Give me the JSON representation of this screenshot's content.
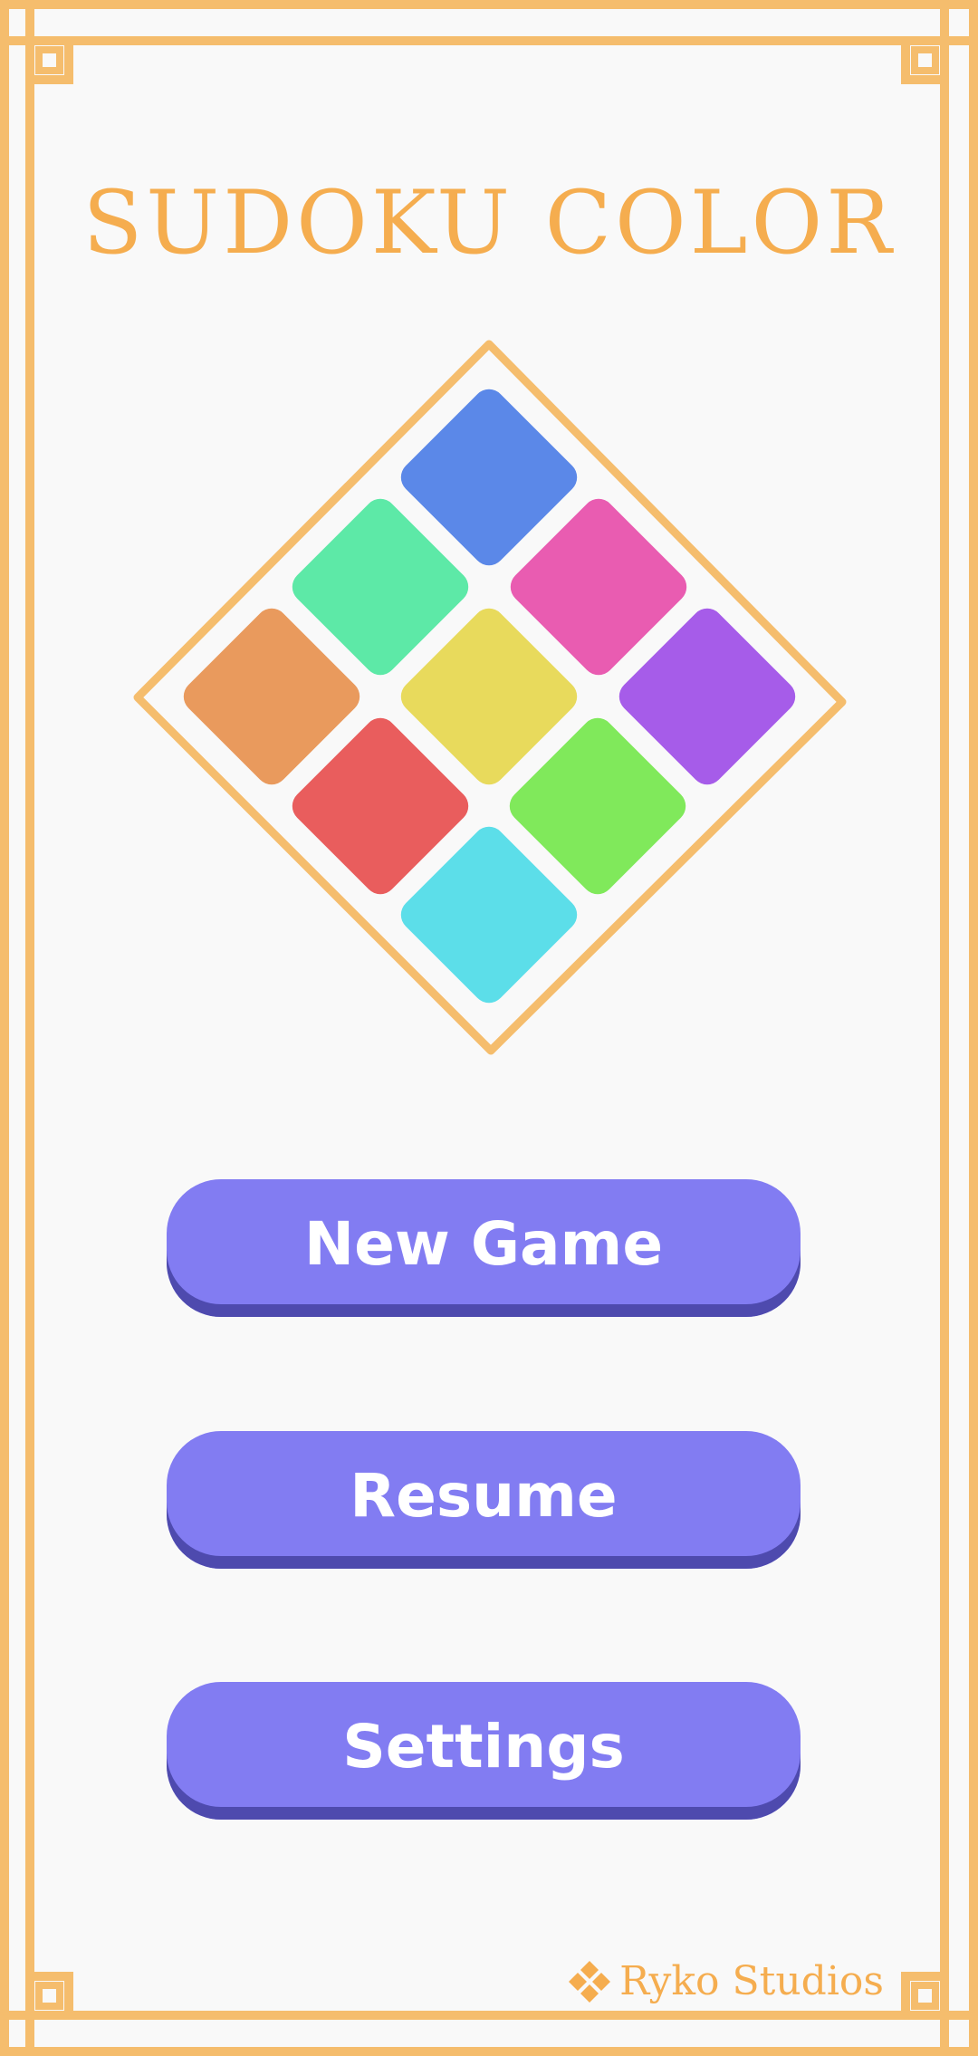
{
  "app": {
    "title": "SUDOKU COLOR"
  },
  "colors": {
    "accent": "#f5ad4f",
    "background": "#f9f9f9",
    "button": "#827cf2",
    "button_shadow": "#4e4aae",
    "tiles": [
      "#5b88e8",
      "#5de9a7",
      "#e95cb1",
      "#e99a5d",
      "#e8da5c",
      "#a65ce9",
      "#e95d5d",
      "#80e95b",
      "#5cdee9"
    ]
  },
  "menu": {
    "new_game_label": "New Game",
    "resume_label": "Resume",
    "settings_label": "Settings"
  },
  "footer": {
    "studio_name": "Ryko Studios",
    "studio_icon": "diamond-cluster-icon"
  }
}
